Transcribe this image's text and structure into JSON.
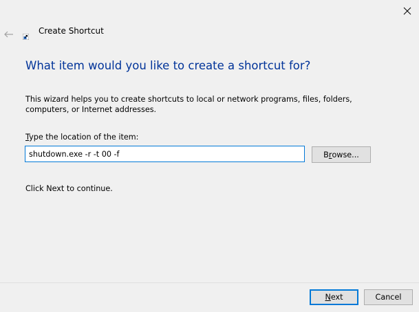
{
  "window": {
    "title": "Create Shortcut",
    "close_glyph": "✕",
    "back_glyph": "←"
  },
  "main": {
    "heading": "What item would you like to create a shortcut for?",
    "description": "This wizard helps you to create shortcuts to local or network programs, files, folders, computers, or Internet addresses.",
    "location_label_accel": "T",
    "location_label_rest": "ype the location of the item:",
    "location_value": "shutdown.exe -r -t 00 -f",
    "browse_accel": "r",
    "browse_pre": "B",
    "browse_post": "owse...",
    "continue_text": "Click Next to continue."
  },
  "footer": {
    "next_accel": "N",
    "next_rest": "ext",
    "cancel_label": "Cancel"
  },
  "colors": {
    "heading": "#003399",
    "background": "#f0f0f0",
    "focus_border": "#0078d7",
    "button_face": "#e1e1e1"
  },
  "icons": {
    "close": "close-icon",
    "back": "back-arrow-icon",
    "shortcut": "shortcut-icon"
  }
}
